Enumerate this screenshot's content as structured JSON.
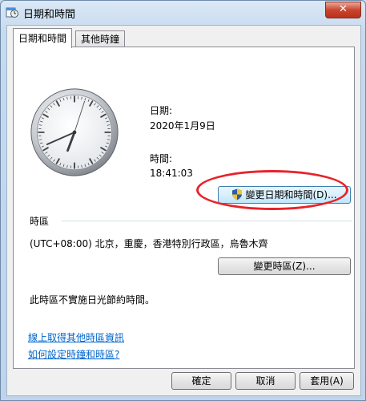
{
  "window": {
    "title": "日期和時間",
    "close_glyph": "✕"
  },
  "tabs": [
    {
      "label": "日期和時間",
      "active": true
    },
    {
      "label": "其他時鐘",
      "active": false
    }
  ],
  "datetime": {
    "date_label": "日期:",
    "date_value": "2020年1月9日",
    "time_label": "時間:",
    "time_value": "18:41:03",
    "change_button": "變更日期和時間(D)..."
  },
  "timezone": {
    "section_label": "時區",
    "value": "(UTC+08:00) 北京，重慶，香港特別行政區，烏魯木齊",
    "change_button": "變更時區(Z)...",
    "dst_note": "此時區不實施日光節約時間。"
  },
  "links": {
    "more_info": "線上取得其他時區資訊",
    "how_to": "如何設定時鐘和時區?"
  },
  "footer": {
    "ok": "確定",
    "cancel": "取消",
    "apply": "套用(A)"
  },
  "colors": {
    "accent_oval": "#e8232a",
    "link": "#0066cc"
  },
  "clock": {
    "hour": 18,
    "minute": 41,
    "second": 3
  }
}
